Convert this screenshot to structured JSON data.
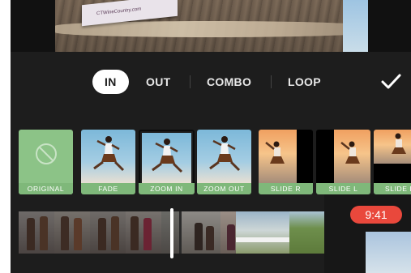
{
  "preview": {
    "card_text": "CTWineCountry.com"
  },
  "tabs": [
    {
      "label": "IN",
      "active": true
    },
    {
      "label": "OUT",
      "active": false
    },
    {
      "label": "COMBO",
      "active": false
    },
    {
      "label": "LOOP",
      "active": false
    }
  ],
  "toolbar": {
    "done_icon": "checkmark-icon"
  },
  "transitions": [
    {
      "label": "ORIGINAL",
      "icon": "no-effect-icon"
    },
    {
      "label": "FADE"
    },
    {
      "label": "ZOOM IN",
      "selected": true
    },
    {
      "label": "ZOOM OUT"
    },
    {
      "label": "SLIDE R"
    },
    {
      "label": "SLIDE L"
    },
    {
      "label": "SLIDE D"
    }
  ],
  "status": {
    "time": "9:41"
  },
  "colors": {
    "accent_green": "#7fb87a",
    "clock_red": "#e9483c",
    "background": "#1d1d1d"
  }
}
